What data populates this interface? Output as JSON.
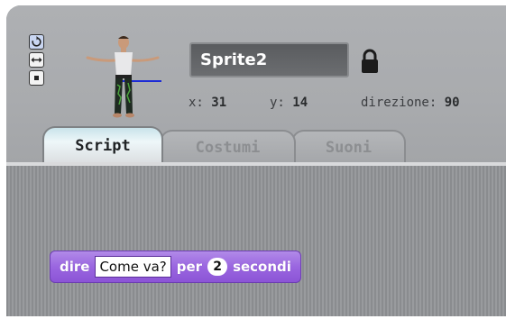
{
  "colors": {
    "panel_bg": "#a9abae",
    "script_area_bg": "#8f9194",
    "looks_block": "#9a66e0",
    "name_field_bg": "#5f6164"
  },
  "rotation_buttons": [
    {
      "icon": "rotate-icon",
      "active": true
    },
    {
      "icon": "flip-left-right-icon",
      "active": false
    },
    {
      "icon": "no-rotate-icon",
      "active": false
    }
  ],
  "sprite": {
    "name": "Sprite2",
    "lock_icon": "lock-icon",
    "x_label": "x:",
    "x_value": "31",
    "y_label": "y:",
    "y_value": "14",
    "direction_label": "direzione:",
    "direction_value": "90"
  },
  "tabs": [
    {
      "label": "Script",
      "active": true
    },
    {
      "label": "Costumi",
      "active": false
    },
    {
      "label": "Suoni",
      "active": false
    }
  ],
  "script": {
    "block": {
      "category": "looks",
      "word1": "dire",
      "message": "Come va?",
      "word2": "per",
      "seconds": "2",
      "word3": "secondi"
    }
  }
}
